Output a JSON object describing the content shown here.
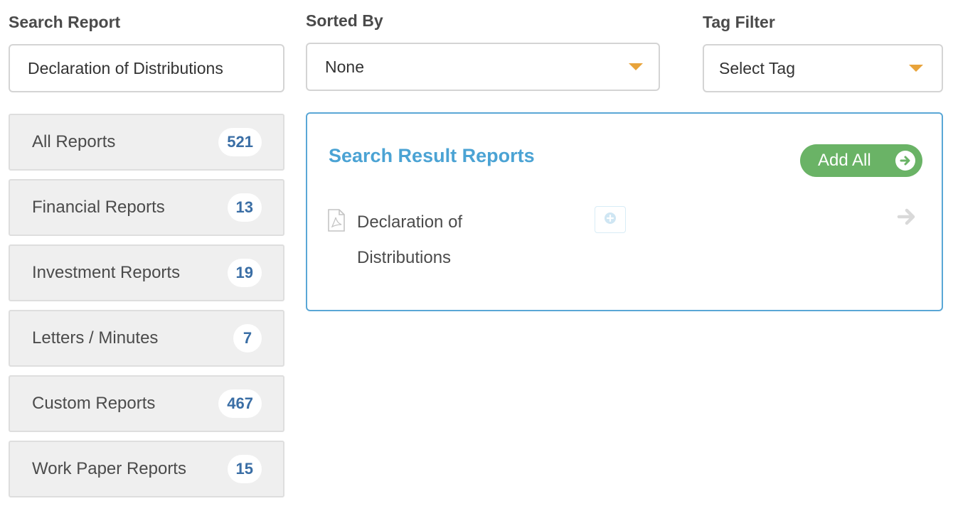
{
  "search": {
    "label": "Search Report",
    "value": "Declaration of Distributions"
  },
  "sort": {
    "label": "Sorted By",
    "selected": "None"
  },
  "tag": {
    "label": "Tag Filter",
    "selected": "Select Tag"
  },
  "categories": [
    {
      "label": "All Reports",
      "count": "521"
    },
    {
      "label": "Financial Reports",
      "count": "13"
    },
    {
      "label": "Investment Reports",
      "count": "19"
    },
    {
      "label": "Letters / Minutes",
      "count": "7"
    },
    {
      "label": "Custom Reports",
      "count": "467"
    },
    {
      "label": "Work Paper Reports",
      "count": "15"
    }
  ],
  "results": {
    "title": "Search Result Reports",
    "add_all_label": "Add All",
    "items": [
      {
        "name_line1": "Declaration of",
        "name_line2": "Distributions"
      }
    ]
  },
  "colors": {
    "accent_blue": "#4ba3d4",
    "badge_text": "#3a6ea5",
    "add_green": "#6ab366",
    "caret": "#e8a33a"
  },
  "icons": [
    "chevron-down-icon",
    "pdf-file-icon",
    "plus-circle-icon",
    "arrow-right-icon",
    "arrow-circle-right-icon"
  ]
}
